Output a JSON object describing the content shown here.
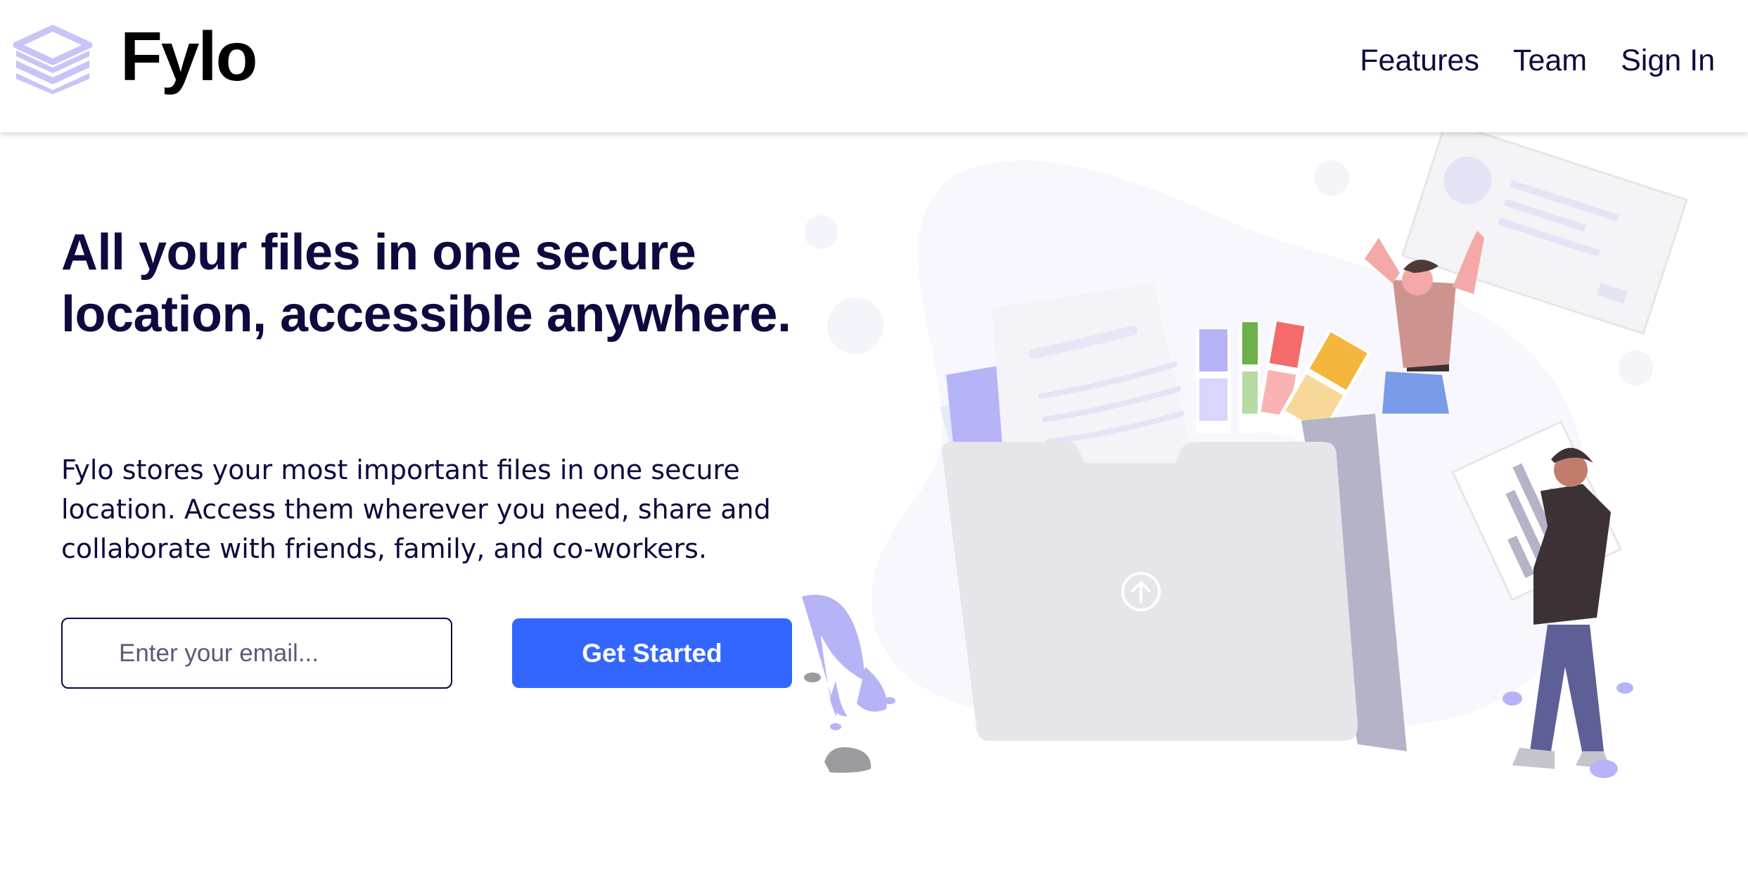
{
  "header": {
    "logo_text": "Fylo",
    "nav": [
      "Features",
      "Team",
      "Sign In"
    ]
  },
  "hero": {
    "headline": "All your files in one secure location, accessible anywhere.",
    "description": "Fylo stores your most important files in one secure location. Access them wherever you need, share and collaborate with friends, family, and co-workers.",
    "email_placeholder": "Enter your email...",
    "cta_label": "Get Started"
  },
  "colors": {
    "navy": "#0c0a3e",
    "accent_blue": "#3366ff",
    "logo_lavender": "#c7c4f7",
    "folder_gray": "#e6e6ea",
    "illustration_purple": "#b6b3f7"
  }
}
